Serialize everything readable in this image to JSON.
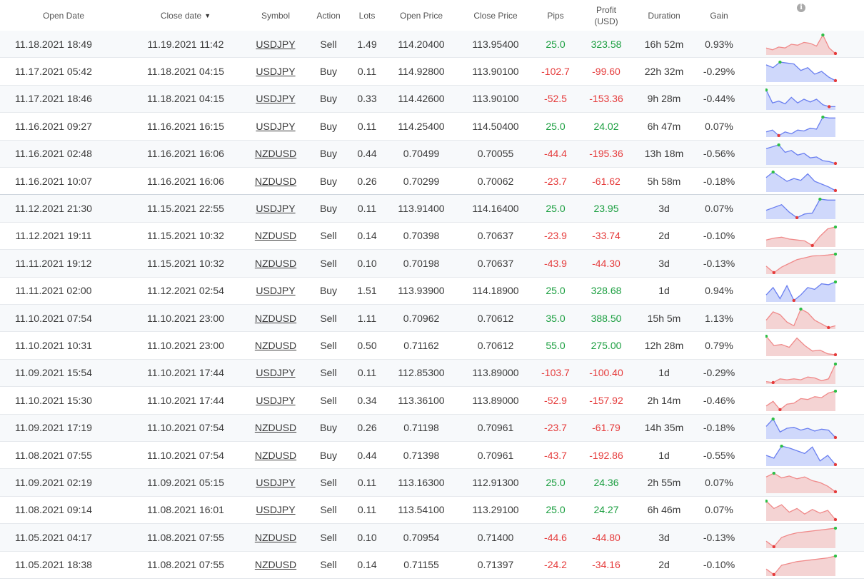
{
  "headers": {
    "open_date": "Open Date",
    "close_date": "Close date",
    "sort_arrow": "▼",
    "symbol": "Symbol",
    "action": "Action",
    "lots": "Lots",
    "open_price": "Open Price",
    "close_price": "Close Price",
    "pips": "Pips",
    "profit_line1": "Profit",
    "profit_line2": "(USD)",
    "duration": "Duration",
    "gain": "Gain",
    "info_glyph": "i"
  },
  "colors": {
    "positive": "#1a9e3f",
    "negative": "#e53b3b",
    "buy_line": "#6a7ff0",
    "buy_fill": "#cfd8fb",
    "sell_line": "#f08a8a",
    "sell_fill": "#f4d3d3",
    "marker_high": "#2ebf47",
    "marker_low": "#e53b3b"
  },
  "trades": [
    {
      "open_date": "11.18.2021 18:49",
      "close_date": "11.19.2021 11:42",
      "symbol": "USDJPY",
      "action": "Sell",
      "lots": "1.49",
      "open_price": "114.20400",
      "close_price": "113.95400",
      "pips": "25.0",
      "profit": "323.58",
      "duration": "16h 52m",
      "gain": "0.93%",
      "spark": [
        0.3,
        0.2,
        0.35,
        0.3,
        0.5,
        0.45,
        0.6,
        0.55,
        0.4,
        1.0,
        0.3,
        0.0
      ]
    },
    {
      "open_date": "11.17.2021 05:42",
      "close_date": "11.18.2021 04:15",
      "symbol": "USDJPY",
      "action": "Buy",
      "lots": "0.11",
      "open_price": "114.92800",
      "close_price": "113.90100",
      "pips": "-102.7",
      "profit": "-99.60",
      "duration": "22h 32m",
      "gain": "-0.29%",
      "spark": [
        0.85,
        0.7,
        1.0,
        0.95,
        0.9,
        0.55,
        0.7,
        0.35,
        0.5,
        0.2,
        0.0
      ]
    },
    {
      "open_date": "11.17.2021 18:46",
      "close_date": "11.18.2021 04:15",
      "symbol": "USDJPY",
      "action": "Buy",
      "lots": "0.33",
      "open_price": "114.42600",
      "close_price": "113.90100",
      "pips": "-52.5",
      "profit": "-153.36",
      "duration": "9h 28m",
      "gain": "-0.44%",
      "spark": [
        1.0,
        0.3,
        0.4,
        0.25,
        0.6,
        0.3,
        0.5,
        0.35,
        0.5,
        0.2,
        0.1,
        0.1
      ]
    },
    {
      "open_date": "11.16.2021 09:27",
      "close_date": "11.16.2021 16:15",
      "symbol": "USDJPY",
      "action": "Buy",
      "lots": "0.11",
      "open_price": "114.25400",
      "close_price": "114.50400",
      "pips": "25.0",
      "profit": "24.02",
      "duration": "6h 47m",
      "gain": "0.07%",
      "spark": [
        0.2,
        0.3,
        0.0,
        0.2,
        0.1,
        0.3,
        0.25,
        0.4,
        0.35,
        1.0,
        0.95,
        0.95
      ]
    },
    {
      "open_date": "11.16.2021 02:48",
      "close_date": "11.16.2021 16:06",
      "symbol": "NZDUSD",
      "action": "Buy",
      "lots": "0.44",
      "open_price": "0.70499",
      "close_price": "0.70055",
      "pips": "-44.4",
      "profit": "-195.36",
      "duration": "13h 18m",
      "gain": "-0.56%",
      "spark": [
        0.8,
        0.9,
        1.0,
        0.6,
        0.7,
        0.45,
        0.55,
        0.3,
        0.35,
        0.15,
        0.1,
        0.0
      ]
    },
    {
      "open_date": "11.16.2021 10:07",
      "close_date": "11.16.2021 16:06",
      "symbol": "NZDUSD",
      "action": "Buy",
      "lots": "0.26",
      "open_price": "0.70299",
      "close_price": "0.70062",
      "pips": "-23.7",
      "profit": "-61.62",
      "duration": "5h 58m",
      "gain": "-0.18%",
      "spark": [
        0.7,
        1.0,
        0.75,
        0.5,
        0.65,
        0.55,
        0.9,
        0.5,
        0.35,
        0.2,
        0.0
      ]
    },
    {
      "open_date": "11.12.2021 21:30",
      "close_date": "11.15.2021 22:55",
      "symbol": "USDJPY",
      "action": "Buy",
      "lots": "0.11",
      "open_price": "113.91400",
      "close_price": "114.16400",
      "pips": "25.0",
      "profit": "23.95",
      "duration": "3d",
      "gain": "0.07%",
      "spark": [
        0.4,
        0.55,
        0.7,
        0.3,
        0.0,
        0.2,
        0.25,
        1.0,
        0.95,
        0.95
      ]
    },
    {
      "open_date": "11.12.2021 19:11",
      "close_date": "11.15.2021 10:32",
      "symbol": "NZDUSD",
      "action": "Sell",
      "lots": "0.14",
      "open_price": "0.70398",
      "close_price": "0.70637",
      "pips": "-23.9",
      "profit": "-33.74",
      "duration": "2d",
      "gain": "-0.10%",
      "spark": [
        0.3,
        0.4,
        0.45,
        0.35,
        0.3,
        0.25,
        0.0,
        0.5,
        0.9,
        1.0
      ]
    },
    {
      "open_date": "11.11.2021 19:12",
      "close_date": "11.15.2021 10:32",
      "symbol": "NZDUSD",
      "action": "Sell",
      "lots": "0.10",
      "open_price": "0.70198",
      "close_price": "0.70637",
      "pips": "-43.9",
      "profit": "-44.30",
      "duration": "3d",
      "gain": "-0.13%",
      "spark": [
        0.35,
        0.0,
        0.3,
        0.5,
        0.7,
        0.8,
        0.9,
        0.92,
        0.95,
        1.0
      ]
    },
    {
      "open_date": "11.11.2021 02:00",
      "close_date": "11.12.2021 02:54",
      "symbol": "USDJPY",
      "action": "Buy",
      "lots": "1.51",
      "open_price": "113.93900",
      "close_price": "114.18900",
      "pips": "25.0",
      "profit": "328.68",
      "duration": "1d",
      "gain": "0.94%",
      "spark": [
        0.3,
        0.7,
        0.1,
        0.8,
        0.0,
        0.3,
        0.7,
        0.6,
        0.9,
        0.85,
        1.0
      ]
    },
    {
      "open_date": "11.10.2021 07:54",
      "close_date": "11.10.2021 23:00",
      "symbol": "NZDUSD",
      "action": "Sell",
      "lots": "1.11",
      "open_price": "0.70962",
      "close_price": "0.70612",
      "pips": "35.0",
      "profit": "388.50",
      "duration": "15h 5m",
      "gain": "1.13%",
      "spark": [
        0.4,
        0.85,
        0.7,
        0.3,
        0.1,
        1.0,
        0.8,
        0.4,
        0.2,
        0.0,
        0.1
      ]
    },
    {
      "open_date": "11.10.2021 10:31",
      "close_date": "11.10.2021 23:00",
      "symbol": "NZDUSD",
      "action": "Sell",
      "lots": "0.50",
      "open_price": "0.71162",
      "close_price": "0.70612",
      "pips": "55.0",
      "profit": "275.00",
      "duration": "12h 28m",
      "gain": "0.79%",
      "spark": [
        1.0,
        0.5,
        0.55,
        0.4,
        0.9,
        0.5,
        0.2,
        0.25,
        0.05,
        0.0
      ]
    },
    {
      "open_date": "11.09.2021 15:54",
      "close_date": "11.10.2021 17:44",
      "symbol": "USDJPY",
      "action": "Sell",
      "lots": "0.11",
      "open_price": "112.85300",
      "close_price": "113.89000",
      "pips": "-103.7",
      "profit": "-100.40",
      "duration": "1d",
      "gain": "-0.29%",
      "spark": [
        0.05,
        0.0,
        0.2,
        0.15,
        0.2,
        0.15,
        0.3,
        0.25,
        0.1,
        0.2,
        1.0
      ]
    },
    {
      "open_date": "11.10.2021 15:30",
      "close_date": "11.10.2021 17:44",
      "symbol": "USDJPY",
      "action": "Sell",
      "lots": "0.34",
      "open_price": "113.36100",
      "close_price": "113.89000",
      "pips": "-52.9",
      "profit": "-157.92",
      "duration": "2h 14m",
      "gain": "-0.46%",
      "spark": [
        0.2,
        0.45,
        0.0,
        0.3,
        0.35,
        0.6,
        0.55,
        0.7,
        0.65,
        0.9,
        1.0
      ]
    },
    {
      "open_date": "11.09.2021 17:19",
      "close_date": "11.10.2021 07:54",
      "symbol": "NZDUSD",
      "action": "Buy",
      "lots": "0.26",
      "open_price": "0.71198",
      "close_price": "0.70961",
      "pips": "-23.7",
      "profit": "-61.79",
      "duration": "14h 35m",
      "gain": "-0.18%",
      "spark": [
        0.6,
        1.0,
        0.3,
        0.5,
        0.55,
        0.4,
        0.5,
        0.35,
        0.45,
        0.4,
        0.0
      ]
    },
    {
      "open_date": "11.08.2021 07:55",
      "close_date": "11.10.2021 07:54",
      "symbol": "NZDUSD",
      "action": "Buy",
      "lots": "0.44",
      "open_price": "0.71398",
      "close_price": "0.70961",
      "pips": "-43.7",
      "profit": "-192.86",
      "duration": "1d",
      "gain": "-0.55%",
      "spark": [
        0.5,
        0.35,
        1.0,
        0.9,
        0.75,
        0.6,
        0.95,
        0.2,
        0.5,
        0.0
      ]
    },
    {
      "open_date": "11.09.2021 02:19",
      "close_date": "11.09.2021 05:15",
      "symbol": "USDJPY",
      "action": "Sell",
      "lots": "0.11",
      "open_price": "113.16300",
      "close_price": "112.91300",
      "pips": "25.0",
      "profit": "24.36",
      "duration": "2h 55m",
      "gain": "0.07%",
      "spark": [
        0.8,
        1.0,
        0.75,
        0.85,
        0.7,
        0.8,
        0.6,
        0.5,
        0.3,
        0.0
      ]
    },
    {
      "open_date": "11.08.2021 09:14",
      "close_date": "11.08.2021 16:01",
      "symbol": "USDJPY",
      "action": "Sell",
      "lots": "0.11",
      "open_price": "113.54100",
      "close_price": "113.29100",
      "pips": "25.0",
      "profit": "24.27",
      "duration": "6h 46m",
      "gain": "0.07%",
      "spark": [
        1.0,
        0.6,
        0.8,
        0.4,
        0.6,
        0.3,
        0.55,
        0.35,
        0.5,
        0.0
      ]
    },
    {
      "open_date": "11.05.2021 04:17",
      "close_date": "11.08.2021 07:55",
      "symbol": "NZDUSD",
      "action": "Sell",
      "lots": "0.10",
      "open_price": "0.70954",
      "close_price": "0.71400",
      "pips": "-44.6",
      "profit": "-44.80",
      "duration": "3d",
      "gain": "-0.13%",
      "spark": [
        0.3,
        0.0,
        0.5,
        0.65,
        0.75,
        0.8,
        0.85,
        0.9,
        0.95,
        1.0
      ]
    },
    {
      "open_date": "11.05.2021 18:38",
      "close_date": "11.08.2021 07:55",
      "symbol": "NZDUSD",
      "action": "Sell",
      "lots": "0.14",
      "open_price": "0.71155",
      "close_price": "0.71397",
      "pips": "-24.2",
      "profit": "-34.16",
      "duration": "2d",
      "gain": "-0.10%",
      "spark": [
        0.3,
        0.0,
        0.5,
        0.6,
        0.7,
        0.75,
        0.8,
        0.85,
        0.9,
        1.0
      ]
    }
  ]
}
